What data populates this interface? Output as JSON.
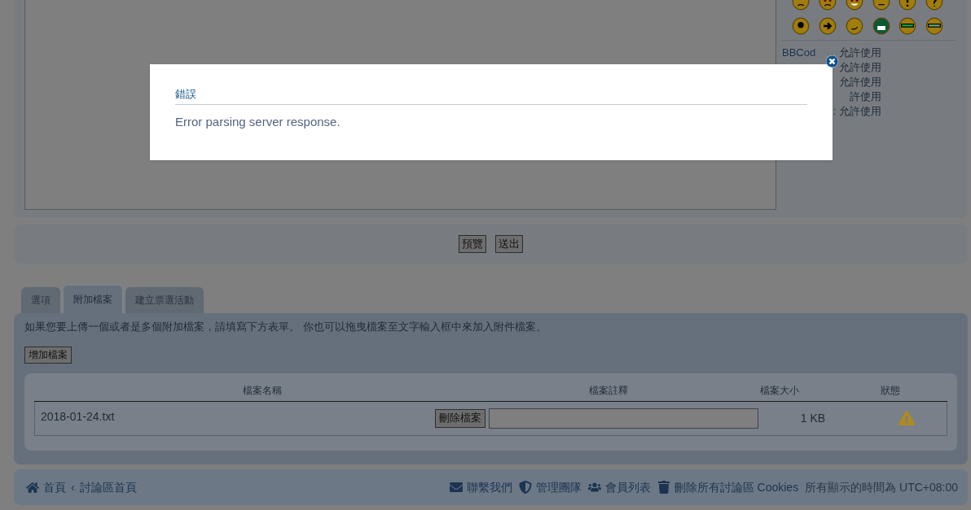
{
  "sidebar": {
    "smileys": [
      {
        "kind": "sad"
      },
      {
        "kind": "angry"
      },
      {
        "kind": "evil"
      },
      {
        "kind": "neutral"
      },
      {
        "kind": "exclaim"
      },
      {
        "kind": "question"
      },
      {
        "kind": "idea"
      },
      {
        "kind": "arrow"
      },
      {
        "kind": "smirk"
      },
      {
        "kind": "green"
      },
      {
        "kind": "glasses"
      },
      {
        "kind": "geek"
      }
    ],
    "bbcode_label": "BBCod",
    "status_lines": [
      "允許使用",
      "允許使用",
      "允許使用",
      "許使用",
      ": 允許使用"
    ]
  },
  "buttons": [
    "預覽",
    "送出"
  ],
  "tabs": [
    {
      "label": "選項",
      "selected": false
    },
    {
      "label": "附加檔案",
      "selected": true
    },
    {
      "label": "建立票選活動",
      "selected": false
    }
  ],
  "attach": {
    "hint": "如果您要上傳一個或者是多個附加檔案，請填寫下方表單。 你也可以拖曳檔案至文字輸入框中來加入附件檔案。",
    "add_button": "增加檔案",
    "columns": [
      "檔案名稱",
      "檔案註釋",
      "檔案大小",
      "狀態"
    ],
    "rows": [
      {
        "name": "2018-01-24.txt",
        "delete": "刪除檔案",
        "size": "1 KB"
      }
    ]
  },
  "footer": {
    "home": "首頁",
    "sep": "‹",
    "forum": "討論區首頁",
    "links": [
      {
        "kind": "mail",
        "label": "聯繫我們"
      },
      {
        "kind": "shield",
        "label": "管理團隊"
      },
      {
        "kind": "users",
        "label": "會員列表"
      },
      {
        "kind": "trash",
        "label": "刪除所有討論區 Cookies"
      }
    ],
    "timezone": "所有顯示的時間為 UTC+08:00"
  },
  "dialog": {
    "title": "錯誤",
    "message": "Error parsing server response."
  }
}
